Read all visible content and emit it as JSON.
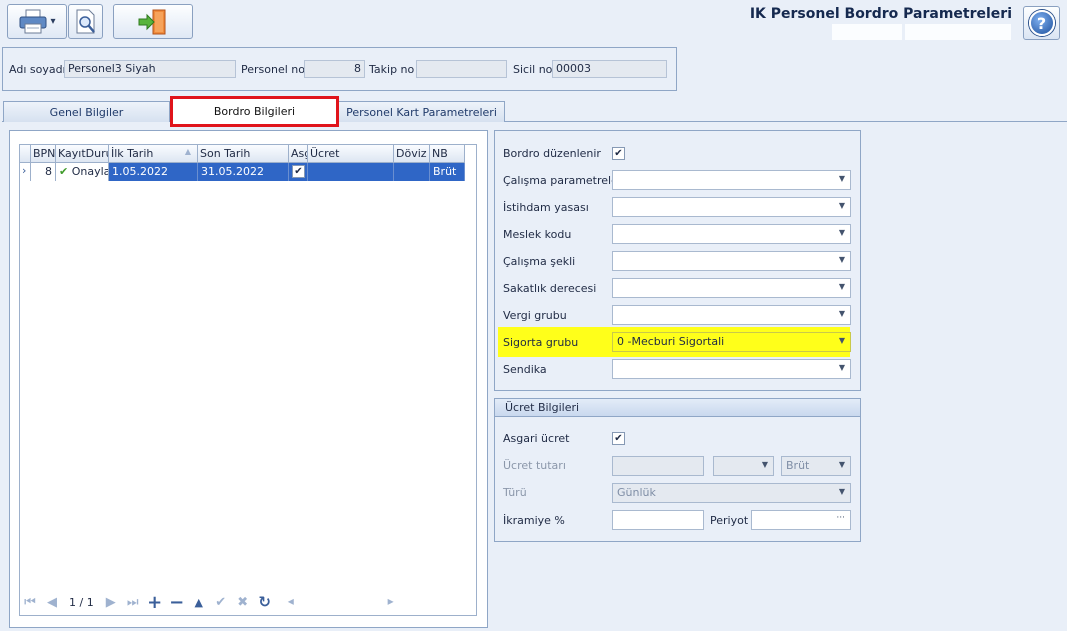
{
  "window": {
    "title": "IK Personel Bordro Parametreleri"
  },
  "toolbar": {
    "print_icon": "printer-icon",
    "preview_icon": "print-preview-icon",
    "exit_icon": "exit-door-icon",
    "dropdown": "▾"
  },
  "help": {
    "label": "?"
  },
  "header": {
    "name_label": "Adı soyadı",
    "name_value": "Personel3 Siyah",
    "personel_no_label": "Personel no",
    "personel_no_value": "8",
    "takip_no_label": "Takip no",
    "takip_no_value": "",
    "sicil_no_label": "Sicil no",
    "sicil_no_value": "00003"
  },
  "tabs": [
    {
      "label": "Genel Bilgiler"
    },
    {
      "label": "Bordro Bilgileri"
    },
    {
      "label": "Personel Kart Parametreleri"
    }
  ],
  "grid": {
    "columns": [
      "BPN",
      "KayıtDurumu",
      "İlk Tarih",
      "Son Tarih",
      "Asgari",
      "Ücret",
      "Döviz",
      "NB"
    ],
    "rows": [
      {
        "indicator": "›",
        "bpn": "8",
        "status_check": "✔",
        "status": "Onaylandı",
        "ilk_tarih": "1.05.2022",
        "son_tarih": "31.05.2022",
        "asgari": "✔",
        "ucret": "",
        "doviz": "",
        "nb": "Brüt"
      }
    ],
    "sort_arrow": "▲"
  },
  "navigator": {
    "page": "1 / 1",
    "first": "⏮",
    "prev": "◀",
    "next": "▶",
    "last": "⏭",
    "add": "+",
    "remove": "−",
    "up": "▲",
    "confirm": "✔",
    "cancel": "✖",
    "refresh": "↻",
    "scroll_left": "◂",
    "scroll_right": "▸"
  },
  "params": {
    "bordro_duzenlenir_label": "Bordro düzenlenir",
    "bordro_duzenlenir_checked": "✔",
    "calisma_parametreleri_label": "Çalışma parametreleri",
    "calisma_parametreleri_value": "",
    "istihdam_yasasi_label": "İstihdam yasası",
    "istihdam_yasasi_value": "",
    "meslek_kodu_label": "Meslek kodu",
    "meslek_kodu_value": "",
    "calisma_sekli_label": "Çalışma şekli",
    "calisma_sekli_value": "",
    "sakatlik_derecesi_label": "Sakatlık derecesi",
    "sakatlik_derecesi_value": "",
    "vergi_grubu_label": "Vergi grubu",
    "vergi_grubu_value": "",
    "sigorta_grubu_label": "Sigorta grubu",
    "sigorta_grubu_value": "0 -Mecburi Sigortali",
    "sendika_label": "Sendika",
    "sendika_value": "",
    "dropdown_arrow": "▼"
  },
  "ucret": {
    "group_title": "Ücret Bilgileri",
    "asgari_ucret_label": "Asgari ücret",
    "asgari_ucret_checked": "✔",
    "ucret_tutari_label": "Ücret tutarı",
    "ucret_tutari_value": "",
    "currency_value": "",
    "brut_value": "Brüt",
    "turu_label": "Türü",
    "turu_value": "Günlük",
    "ikramiye_label": "İkramiye %",
    "ikramiye_value": "",
    "periyot_label": "Periyot",
    "periyot_value": "",
    "ellipsis": "···"
  },
  "colors": {
    "highlight": "#ffff1a",
    "selected_row": "#2f66c6",
    "active_tab_border": "#e0141b"
  }
}
